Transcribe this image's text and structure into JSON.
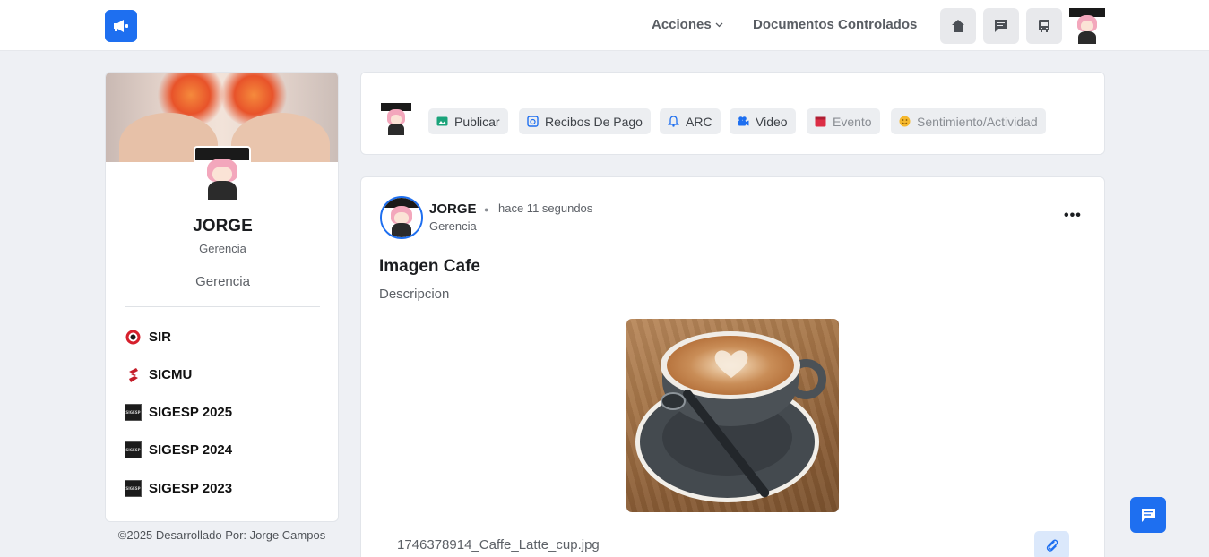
{
  "header": {
    "nav_acciones": "Acciones",
    "nav_documentos": "Documentos Controlados",
    "icons": [
      "home-icon",
      "message-icon",
      "bus-icon"
    ],
    "accent_color": "#1e6ff0"
  },
  "profile": {
    "name": "JORGE",
    "role": "Gerencia",
    "department": "Gerencia",
    "links": [
      {
        "label": "SIR",
        "icon": "sir-icon"
      },
      {
        "label": "SICMU",
        "icon": "sicmu-icon"
      },
      {
        "label": "SIGESP 2025",
        "icon": "sigesp-icon"
      },
      {
        "label": "SIGESP 2024",
        "icon": "sigesp-icon"
      },
      {
        "label": "SIGESP 2023",
        "icon": "sigesp-icon"
      }
    ],
    "sigesp_badge": "SIGESP"
  },
  "footer": {
    "text": "©2025 Desarrollado Por: Jorge Campos"
  },
  "composer": {
    "actions": [
      {
        "label": "Publicar",
        "icon": "image-icon",
        "color": "#1aa37a"
      },
      {
        "label": "Recibos De Pago",
        "icon": "receipt-icon",
        "color": "#1e6ff0"
      },
      {
        "label": "ARC",
        "icon": "bell-icon",
        "color": "#1e6ff0"
      },
      {
        "label": "Video",
        "icon": "video-icon",
        "color": "#1e6ff0"
      },
      {
        "label": "Evento",
        "icon": "calendar-icon",
        "color": "#dc2e45"
      },
      {
        "label": "Sentimiento/Actividad",
        "icon": "smiley-icon",
        "color": "#f5b82e"
      }
    ]
  },
  "post": {
    "author": "JORGE",
    "time": "hace 11 segundos",
    "role": "Gerencia",
    "title": "Imagen Cafe",
    "description": "Descripcion",
    "attachment_name": "1746378914_Caffe_Latte_cup.jpg",
    "menu_icon": "more-horizontal-icon"
  }
}
